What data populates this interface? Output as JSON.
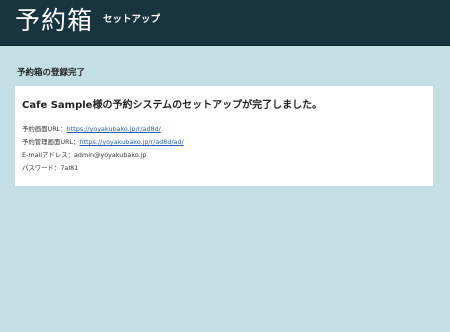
{
  "header": {
    "logo_text": "予約箱",
    "subtitle": "セットアップ",
    "background_color": "#17343f"
  },
  "main": {
    "section_title": "予約箱の登録完了",
    "background_color": "#c3dfe4",
    "card": {
      "heading": "Cafe Sample様の予約システムのセットアップが完了しました。",
      "rows": [
        {
          "label": "予約画面URL：",
          "value": "https://yoyakubako.jp/r/ad8d/",
          "is_link": true
        },
        {
          "label": "予約管理画面URL：",
          "value": "https://yoyakubako.jp/r/ad8d/ad/",
          "is_link": true
        },
        {
          "label": "E-mailアドレス：",
          "value": "admin@yoyakubako.jp",
          "is_link": false
        },
        {
          "label": "パスワード：",
          "value": "7al81",
          "is_link": false
        }
      ]
    }
  }
}
